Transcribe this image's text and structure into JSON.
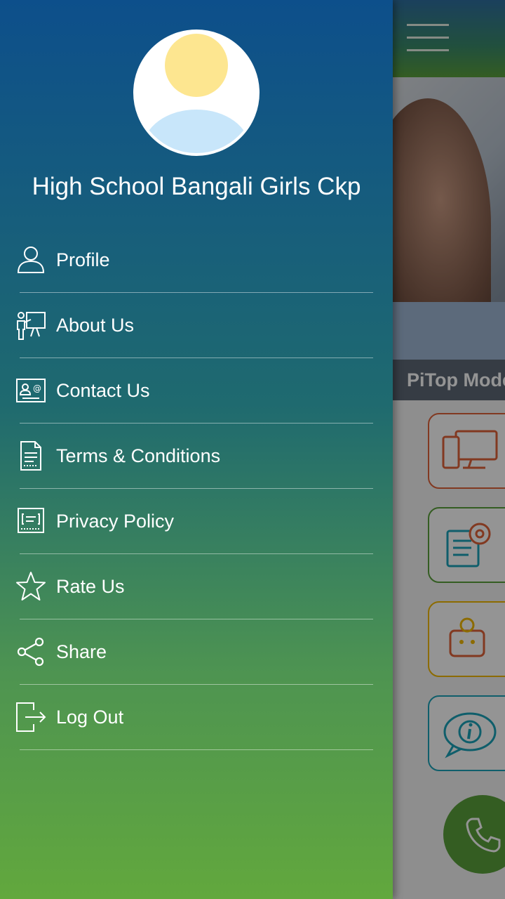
{
  "drawer": {
    "school_name": "High School Bangali Girls Ckp",
    "menu_items": [
      {
        "label": "Profile",
        "icon": "user-icon"
      },
      {
        "label": "About Us",
        "icon": "presentation-icon"
      },
      {
        "label": "Contact Us",
        "icon": "contact-card-icon"
      },
      {
        "label": "Terms & Conditions",
        "icon": "document-icon"
      },
      {
        "label": "Privacy Policy",
        "icon": "policy-icon"
      },
      {
        "label": "Rate Us",
        "icon": "star-icon"
      },
      {
        "label": "Share",
        "icon": "share-icon"
      },
      {
        "label": "Log Out",
        "icon": "logout-icon"
      }
    ]
  },
  "background_app": {
    "banner_caption": "PiTop Mode",
    "tiles": [
      {
        "icon": "devices-icon",
        "color": "#e0623a"
      },
      {
        "icon": "settings-document-icon",
        "color": "#5aa03c"
      },
      {
        "icon": "chat-bot-icon",
        "color": "#f2b800"
      },
      {
        "icon": "info-chat-icon",
        "color": "#1aa3b8"
      }
    ],
    "fab_icon": "phone-icon"
  },
  "colors": {
    "drawer_top": "#0d4f8b",
    "drawer_bottom": "#62a83d",
    "accent_green": "#5aa03c"
  }
}
